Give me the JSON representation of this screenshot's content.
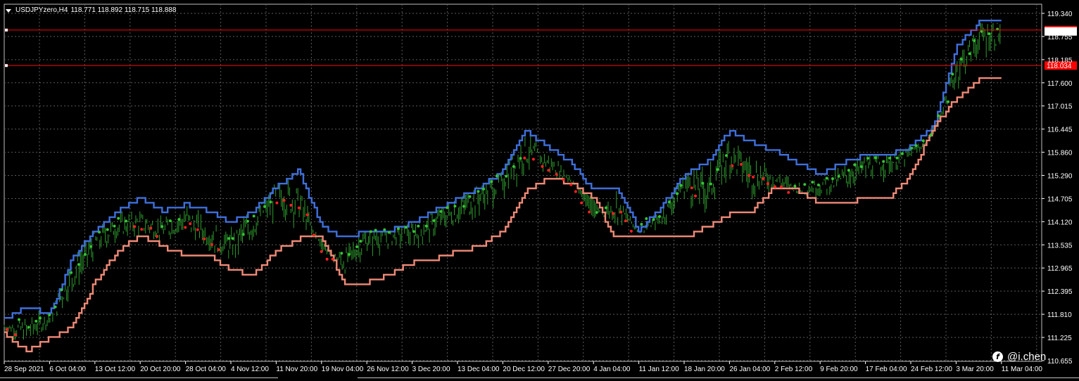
{
  "header": {
    "symbol": "USDJPYzero,H4",
    "ohlc": "118.771 118.892 118.715 118.888"
  },
  "watermark": {
    "icon": "facebook-icon",
    "text": "@i.chen"
  },
  "colors": {
    "background": "#000000",
    "grid": "#5a5a5a",
    "axis": "#ffffff",
    "upper_line": "#3f6fdc",
    "lower_line": "#f08a78",
    "candles": "#2e9c2e",
    "dot_buy": "#35c435",
    "dot_sell": "#ff2020",
    "hline": "#ff0000"
  },
  "chart_data": {
    "type": "line",
    "ylim": [
      110.65,
      119.34
    ],
    "y_ticks": [
      "119.340",
      "118.755",
      "118.185",
      "117.600",
      "117.015",
      "116.445",
      "115.860",
      "115.290",
      "114.705",
      "114.120",
      "113.535",
      "112.965",
      "112.395",
      "111.810",
      "111.225",
      "110.655"
    ],
    "y_tick_values": [
      119.34,
      118.755,
      118.185,
      117.6,
      117.015,
      116.445,
      115.86,
      115.29,
      114.705,
      114.12,
      113.535,
      112.965,
      112.395,
      111.81,
      111.225,
      110.655
    ],
    "x_ticks": [
      "28 Sep 2021",
      "6 Oct 04:00",
      "13 Oct 12:00",
      "20 Oct 20:00",
      "28 Oct 04:00",
      "4 Nov 12:00",
      "11 Nov 20:00",
      "19 Nov 04:00",
      "26 Nov 12:00",
      "3 Dec 20:00",
      "13 Dec 04:00",
      "20 Dec 12:00",
      "27 Dec 20:00",
      "4 Jan 04:00",
      "11 Jan 12:00",
      "18 Jan 20:00",
      "26 Jan 04:00",
      "2 Feb 12:00",
      "9 Feb 20:00",
      "17 Feb 04:00",
      "24 Feb 12:00",
      "3 Mar 20:00",
      "11 Mar 04:00"
    ],
    "price_levels": [
      {
        "value": 118.922,
        "label": "118.922"
      },
      {
        "value": 118.034,
        "label": "118.034"
      }
    ],
    "series": [
      {
        "id": "upper",
        "x": [
          0,
          0.5,
          1,
          1.5,
          2,
          2.5,
          3,
          3.5,
          4,
          4.5,
          5,
          5.5,
          6,
          6.5,
          7,
          7.5,
          8,
          8.5,
          9,
          9.5,
          10,
          10.5,
          11,
          11.5,
          12,
          12.5,
          13,
          13.5,
          14,
          14.5,
          15,
          15.5,
          16,
          16.5,
          17,
          17.5,
          18,
          18.5,
          19,
          19.5,
          20,
          20.5,
          21,
          21.5,
          22
        ],
        "values": [
          111.7,
          112.0,
          111.8,
          113.2,
          113.9,
          114.4,
          114.7,
          114.4,
          114.55,
          114.4,
          114.1,
          114.4,
          115.0,
          115.4,
          114.0,
          113.7,
          113.9,
          113.9,
          114.1,
          114.4,
          114.7,
          115.0,
          115.4,
          116.4,
          116.0,
          115.6,
          114.9,
          115.0,
          113.9,
          114.5,
          115.3,
          115.6,
          116.4,
          116.1,
          115.9,
          115.6,
          115.3,
          115.6,
          115.8,
          115.8,
          116.0,
          116.5,
          118.5,
          119.1,
          119.1
        ]
      },
      {
        "id": "lower",
        "x": [
          0,
          0.5,
          1,
          1.5,
          2,
          2.5,
          3,
          3.5,
          4,
          4.5,
          5,
          5.5,
          6,
          6.5,
          7,
          7.5,
          8,
          8.5,
          9,
          9.5,
          10,
          10.5,
          11,
          11.5,
          12,
          12.5,
          13,
          13.5,
          14,
          14.5,
          15,
          15.5,
          16,
          16.5,
          17,
          17.5,
          18,
          18.5,
          19,
          19.5,
          20,
          20.5,
          21,
          21.5,
          22
        ],
        "values": [
          111.3,
          110.9,
          111.2,
          111.5,
          112.6,
          113.4,
          113.8,
          113.5,
          113.3,
          113.3,
          112.9,
          112.8,
          113.4,
          113.7,
          113.7,
          112.6,
          112.6,
          112.8,
          113.1,
          113.2,
          113.4,
          113.5,
          113.9,
          114.9,
          115.2,
          115.1,
          114.7,
          113.7,
          113.7,
          113.8,
          113.7,
          114.0,
          114.3,
          114.4,
          115.0,
          114.9,
          114.6,
          114.6,
          114.7,
          114.7,
          115.3,
          116.5,
          117.2,
          117.7,
          117.7
        ]
      },
      {
        "id": "price",
        "x": [
          0,
          0.5,
          1,
          1.5,
          2,
          2.5,
          3,
          3.5,
          4,
          4.5,
          5,
          5.5,
          6,
          6.5,
          7,
          7.5,
          8,
          8.5,
          9,
          9.5,
          10,
          10.5,
          11,
          11.5,
          12,
          12.5,
          13,
          13.5,
          14,
          14.5,
          15,
          15.5,
          16,
          16.5,
          17,
          17.5,
          18,
          18.5,
          19,
          19.5,
          20,
          20.5,
          21,
          21.5,
          22
        ],
        "values": [
          111.5,
          111.4,
          111.7,
          112.8,
          113.6,
          114.0,
          114.1,
          113.9,
          114.2,
          113.8,
          113.5,
          114.1,
          114.8,
          114.6,
          113.4,
          113.1,
          113.7,
          113.8,
          113.8,
          114.1,
          114.4,
          114.8,
          115.2,
          115.9,
          115.6,
          115.2,
          114.2,
          114.5,
          113.9,
          114.2,
          115.1,
          114.9,
          115.8,
          115.3,
          115.2,
          114.9,
          115.0,
          115.2,
          115.5,
          115.6,
          115.8,
          116.3,
          117.9,
          118.7,
          118.9
        ]
      }
    ]
  }
}
